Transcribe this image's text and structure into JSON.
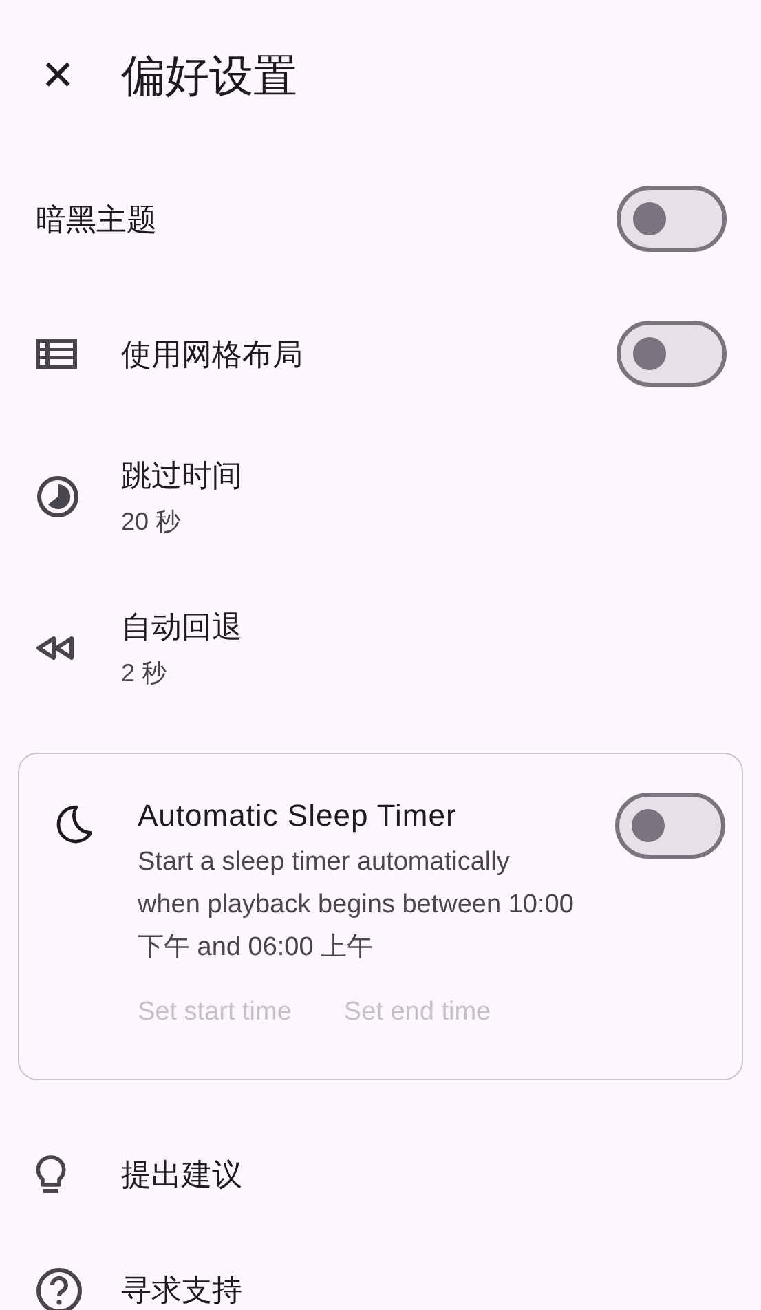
{
  "header": {
    "close": "✕",
    "title": "偏好设置"
  },
  "items": [
    {
      "kind": "switch",
      "title": "暗黑主题",
      "on": false
    },
    {
      "kind": "switch",
      "title": "使用网格布局",
      "on": false
    },
    {
      "kind": "value",
      "title": "跳过时间",
      "value": "20 秒"
    },
    {
      "kind": "value",
      "title": "自动回退",
      "value": "2 秒"
    }
  ],
  "sleep_timer": {
    "title": "Automatic Sleep Timer",
    "description": "Start a sleep timer automatically when playback begins between 10:00 下午 and 06:00 上午",
    "on": false,
    "buttons": [
      {
        "label": "Set start time",
        "disabled": true
      },
      {
        "label": "Set end time",
        "disabled": true
      }
    ]
  },
  "links": [
    {
      "title": "提出建议"
    },
    {
      "title": "寻求支持"
    }
  ]
}
